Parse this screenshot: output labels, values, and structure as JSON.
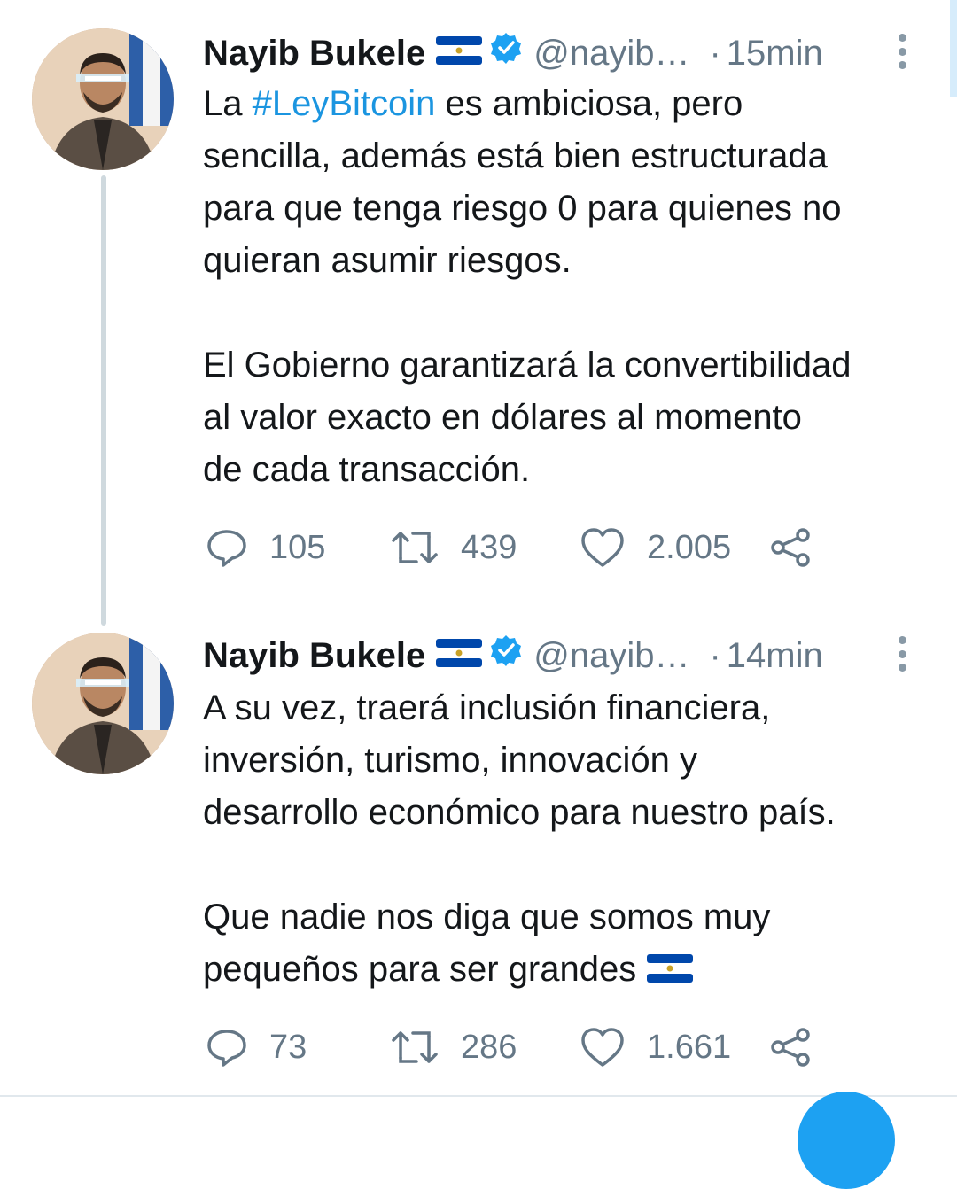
{
  "tweets": [
    {
      "author_name": "Nayib Bukele",
      "flag_emoji": "🇸🇻",
      "handle": "@nayib…",
      "separator": "·",
      "time": "15min",
      "text_lines": [
        [
          "La ",
          "#LeyBitcoin",
          " es ambiciosa, pero"
        ],
        "sencilla, además está bien estructurada",
        "para que tenga riesgo 0 para quienes no",
        "quieran asumir riesgos."
      ],
      "text_lines_2": [
        "El Gobierno garantizará la convertibilidad",
        "al valor exacto en dólares al momento",
        "de cada transacción."
      ],
      "hashtag": "#LeyBitcoin",
      "replies": "105",
      "retweets": "439",
      "likes": "2.005"
    },
    {
      "author_name": "Nayib Bukele",
      "flag_emoji": "🇸🇻",
      "handle": "@nayib…",
      "separator": "·",
      "time": "14min",
      "text_lines": [
        "A su vez, traerá inclusión financiera,",
        "inversión, turismo, innovación y",
        "desarrollo económico para nuestro país."
      ],
      "text_lines_2": [
        "Que nadie nos diga que somos muy",
        "pequeños para ser grandes"
      ],
      "replies": "73",
      "retweets": "286",
      "likes": "1.661"
    }
  ],
  "colors": {
    "hashtag": "#1b95e0",
    "verified": "#1da1f2",
    "muted": "#657786",
    "thread_line": "#cfd9de",
    "flag_blue": "#0047ab"
  },
  "icons": [
    "reply-icon",
    "retweet-icon",
    "like-icon",
    "share-icon",
    "verified-badge-icon",
    "more-options-icon"
  ]
}
